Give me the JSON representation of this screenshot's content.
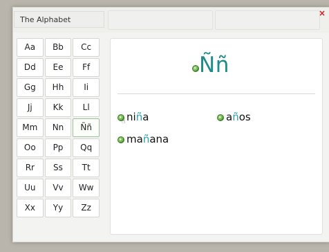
{
  "window": {
    "title": "The Alphabet",
    "close_glyph": "×"
  },
  "letters": [
    "Aa",
    "Bb",
    "Cc",
    "Dd",
    "Ee",
    "Ff",
    "Gg",
    "Hh",
    "Ii",
    "Jj",
    "Kk",
    "Ll",
    "Mm",
    "Nn",
    "Ññ",
    "Oo",
    "Pp",
    "Qq",
    "Rr",
    "Ss",
    "Tt",
    "Uu",
    "Vv",
    "Ww",
    "Xx",
    "Yy",
    "Zz"
  ],
  "selected_letter": "Ññ",
  "panel": {
    "letter": "Ññ",
    "words": [
      {
        "before": "ni",
        "highlight": "ñ",
        "after": "a"
      },
      {
        "before": "a",
        "highlight": "ñ",
        "after": "os"
      },
      {
        "before": "ma",
        "highlight": "ñ",
        "after": "ana"
      }
    ]
  },
  "colors": {
    "letter_accent": "#1f8c8c",
    "highlight": "#2b9fb4",
    "close": "#d61a1a",
    "sound_icon": "#7fc15e"
  },
  "icons": {
    "sound": "speaker-play-icon",
    "close": "close-icon",
    "cursor": "hand-cursor-icon"
  }
}
